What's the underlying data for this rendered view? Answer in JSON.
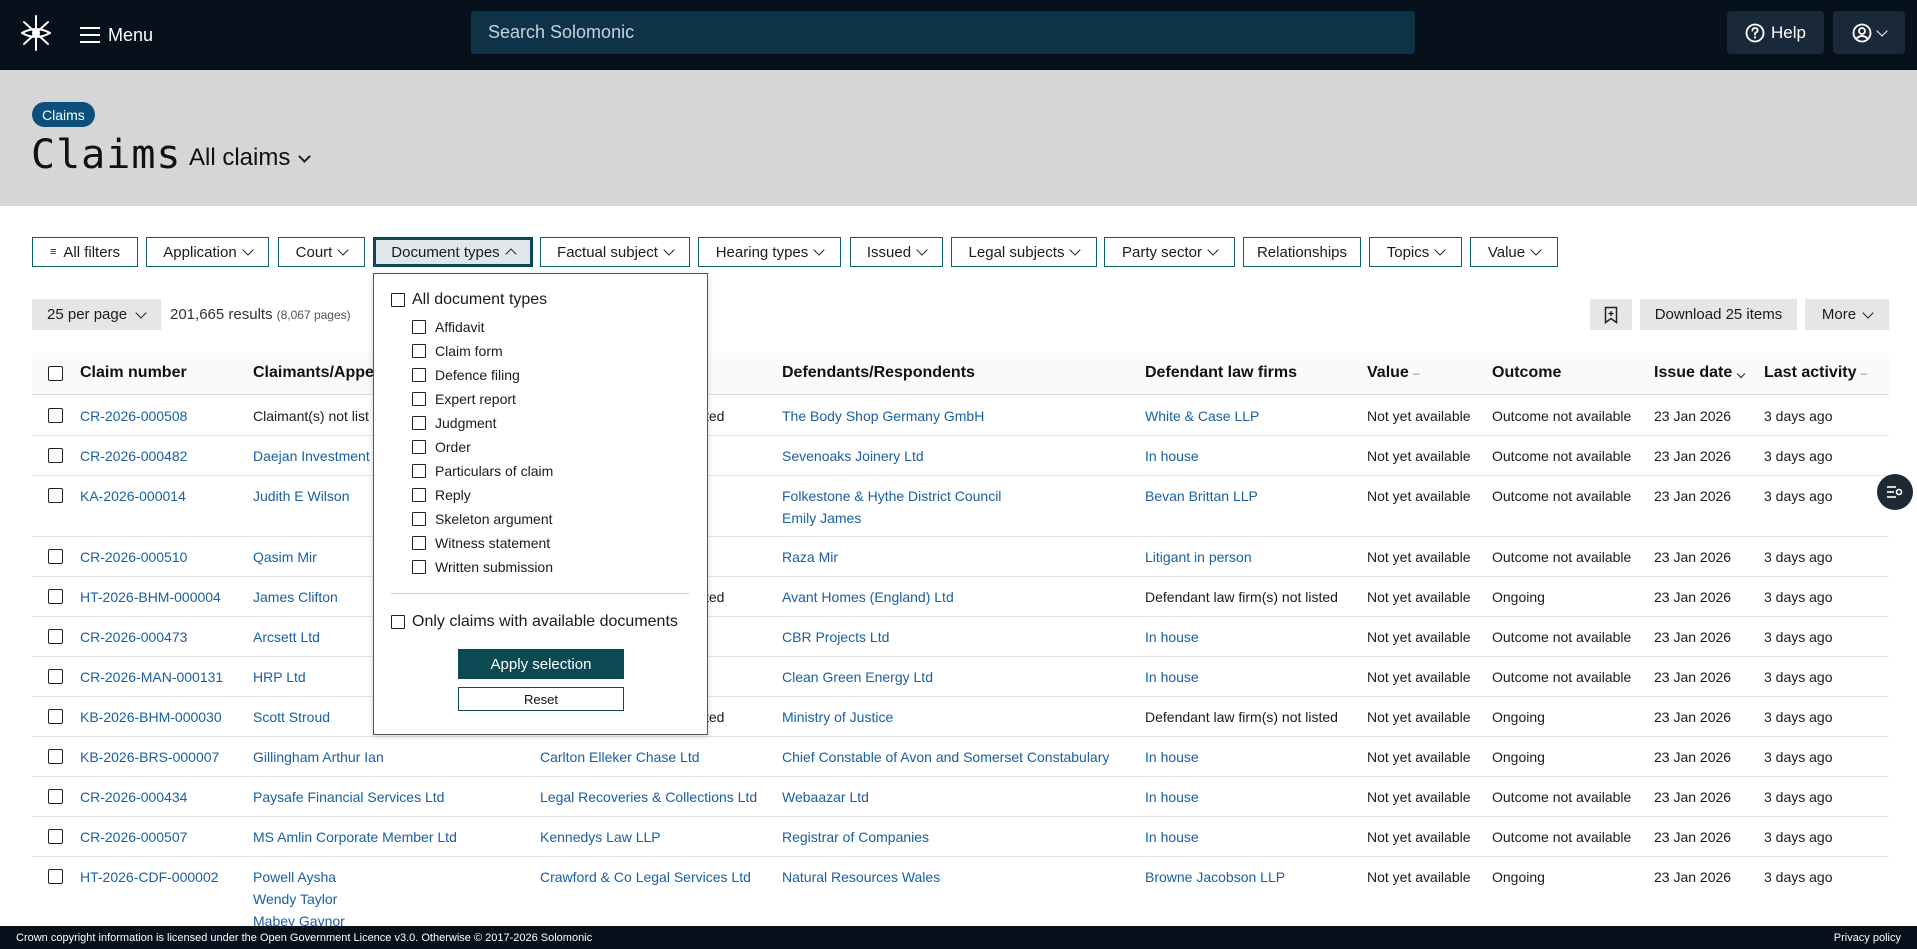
{
  "nav": {
    "menu_label": "Menu",
    "search_placeholder": "Search Solomonic",
    "help_label": "Help"
  },
  "header": {
    "breadcrumb_pill": "Claims",
    "title": "Claims",
    "view_select": "All claims"
  },
  "filters": [
    {
      "label": "All filters",
      "icon": "filter-lines-icon"
    },
    {
      "label": "Application"
    },
    {
      "label": "Court"
    },
    {
      "label": "Document types",
      "active": true
    },
    {
      "label": "Factual subject"
    },
    {
      "label": "Hearing types"
    },
    {
      "label": "Issued"
    },
    {
      "label": "Legal subjects"
    },
    {
      "label": "Party sector"
    },
    {
      "label": "Relationships"
    },
    {
      "label": "Topics"
    },
    {
      "label": "Value"
    }
  ],
  "toolbar": {
    "per_page": "25 per page",
    "results": "201,665 results",
    "pages": "(8,067 pages)",
    "download": "Download 25 items",
    "more": "More"
  },
  "table": {
    "columns": [
      "Claim number",
      "Claimants/Appe",
      "Defendants/Respondents",
      "Defendant law firms",
      "Value",
      "Outcome",
      "Issue date",
      "Last activity"
    ],
    "rows": [
      {
        "claim": "CR-2026-000508",
        "claimants": [
          "Claimant(s) not list"
        ],
        "claimant_linked": false,
        "claimant_firm": "sted",
        "firm_linked": false,
        "defendants": [
          "The Body Shop Germany GmbH"
        ],
        "def_firm": "White & Case LLP",
        "def_firm_linked": true,
        "value": "Not yet available",
        "outcome": "Outcome not available",
        "date": "23 Jan 2026",
        "activity": "3 days ago"
      },
      {
        "claim": "CR-2026-000482",
        "claimants": [
          "Daejan Investment"
        ],
        "claimant_linked": true,
        "claimant_firm": "",
        "firm_linked": true,
        "defendants": [
          "Sevenoaks Joinery Ltd"
        ],
        "def_firm": "In house",
        "def_firm_linked": true,
        "value": "Not yet available",
        "outcome": "Outcome not available",
        "date": "23 Jan 2026",
        "activity": "3 days ago"
      },
      {
        "claim": "KA-2026-000014",
        "claimants": [
          "Judith E Wilson"
        ],
        "claimant_linked": true,
        "claimant_firm": "",
        "firm_linked": true,
        "defendants": [
          "Folkestone & Hythe District Council",
          "Emily James"
        ],
        "def_firm": "Bevan Brittan LLP",
        "def_firm_linked": true,
        "value": "Not yet available",
        "outcome": "Outcome not available",
        "date": "23 Jan 2026",
        "activity": "3 days ago"
      },
      {
        "claim": "CR-2026-000510",
        "claimants": [
          "Qasim Mir"
        ],
        "claimant_linked": true,
        "claimant_firm": "",
        "firm_linked": true,
        "defendants": [
          "Raza Mir"
        ],
        "def_firm": "Litigant in person",
        "def_firm_linked": true,
        "value": "Not yet available",
        "outcome": "Outcome not available",
        "date": "23 Jan 2026",
        "activity": "3 days ago"
      },
      {
        "claim": "HT-2026-BHM-000004",
        "claimants": [
          "James Clifton"
        ],
        "claimant_linked": true,
        "claimant_firm": "sted",
        "firm_linked": false,
        "defendants": [
          "Avant Homes (England) Ltd"
        ],
        "def_firm": "Defendant law firm(s) not listed",
        "def_firm_linked": false,
        "value": "Not yet available",
        "outcome": "Ongoing",
        "date": "23 Jan 2026",
        "activity": "3 days ago"
      },
      {
        "claim": "CR-2026-000473",
        "claimants": [
          "Arcsett Ltd"
        ],
        "claimant_linked": true,
        "claimant_firm": "",
        "firm_linked": true,
        "defendants": [
          "CBR Projects Ltd"
        ],
        "def_firm": "In house",
        "def_firm_linked": true,
        "value": "Not yet available",
        "outcome": "Outcome not available",
        "date": "23 Jan 2026",
        "activity": "3 days ago"
      },
      {
        "claim": "CR-2026-MAN-000131",
        "claimants": [
          "HRP Ltd"
        ],
        "claimant_linked": true,
        "claimant_firm": "",
        "firm_linked": true,
        "defendants": [
          "Clean Green Energy Ltd"
        ],
        "def_firm": "In house",
        "def_firm_linked": true,
        "value": "Not yet available",
        "outcome": "Outcome not available",
        "date": "23 Jan 2026",
        "activity": "3 days ago"
      },
      {
        "claim": "KB-2026-BHM-000030",
        "claimants": [
          "Scott Stroud"
        ],
        "claimant_linked": true,
        "claimant_firm": "sted",
        "firm_linked": false,
        "defendants": [
          "Ministry of Justice"
        ],
        "def_firm": "Defendant law firm(s) not listed",
        "def_firm_linked": false,
        "value": "Not yet available",
        "outcome": "Ongoing",
        "date": "23 Jan 2026",
        "activity": "3 days ago"
      },
      {
        "claim": "KB-2026-BRS-000007",
        "claimants": [
          "Gillingham Arthur Ian"
        ],
        "claimant_linked": true,
        "claimant_firm": "Carlton Elleker Chase Ltd",
        "firm_linked": true,
        "defendants": [
          "Chief Constable of Avon and Somerset Constabulary"
        ],
        "def_firm": "In house",
        "def_firm_linked": true,
        "value": "Not yet available",
        "outcome": "Ongoing",
        "date": "23 Jan 2026",
        "activity": "3 days ago"
      },
      {
        "claim": "CR-2026-000434",
        "claimants": [
          "Paysafe Financial Services Ltd"
        ],
        "claimant_linked": true,
        "claimant_firm": "Legal Recoveries & Collections Ltd",
        "firm_linked": true,
        "defendants": [
          "Webaazar Ltd"
        ],
        "def_firm": "In house",
        "def_firm_linked": true,
        "value": "Not yet available",
        "outcome": "Outcome not available",
        "date": "23 Jan 2026",
        "activity": "3 days ago"
      },
      {
        "claim": "CR-2026-000507",
        "claimants": [
          "MS Amlin Corporate Member Ltd"
        ],
        "claimant_linked": true,
        "claimant_firm": "Kennedys Law LLP",
        "firm_linked": true,
        "defendants": [
          "Registrar of Companies"
        ],
        "def_firm": "In house",
        "def_firm_linked": true,
        "value": "Not yet available",
        "outcome": "Outcome not available",
        "date": "23 Jan 2026",
        "activity": "3 days ago"
      },
      {
        "claim": "HT-2026-CDF-000002",
        "claimants": [
          "Powell Aysha",
          "Wendy Taylor",
          "Mabey Gaynor"
        ],
        "claimant_linked": true,
        "claimant_firm": "Crawford & Co Legal Services Ltd",
        "firm_linked": true,
        "defendants": [
          "Natural Resources Wales"
        ],
        "def_firm": "Browne Jacobson LLP",
        "def_firm_linked": true,
        "value": "Not yet available",
        "outcome": "Ongoing",
        "date": "23 Jan 2026",
        "activity": "3 days ago"
      }
    ]
  },
  "dropdown": {
    "all_label": "All document types",
    "items": [
      "Affidavit",
      "Claim form",
      "Defence filing",
      "Expert report",
      "Judgment",
      "Order",
      "Particulars of claim",
      "Reply",
      "Skeleton argument",
      "Witness statement",
      "Written submission"
    ],
    "only_available": "Only claims with available documents",
    "apply": "Apply selection",
    "reset": "Reset"
  },
  "footer": {
    "licence": "Crown copyright information is licensed under the Open Government Licence v3.0. Otherwise © 2017-2026 Solomonic",
    "privacy": "Privacy policy"
  }
}
